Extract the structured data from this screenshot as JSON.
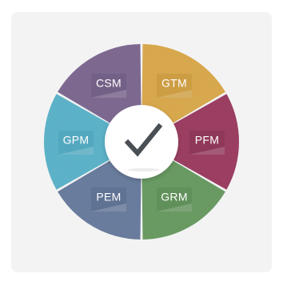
{
  "center": {
    "icon": "checkmark-icon"
  },
  "segments": [
    {
      "label": "CSM",
      "color": "#7e6a91",
      "tab": "#6c5a7f"
    },
    {
      "label": "GTM",
      "color": "#d9a94e",
      "tab": "#c5953c"
    },
    {
      "label": "PFM",
      "color": "#9c3f62",
      "tab": "#873354"
    },
    {
      "label": "GRM",
      "color": "#6a9b63",
      "tab": "#5a8953"
    },
    {
      "label": "PEM",
      "color": "#6a7d9e",
      "tab": "#5a6c8c"
    },
    {
      "label": "GPM",
      "color": "#5db3c9",
      "tab": "#4aa1b8"
    }
  ],
  "colors": {
    "background_card": "#f3f3f4",
    "separator": "#ffffff",
    "center_fill": "#ffffff",
    "check": "#4a4f54"
  }
}
